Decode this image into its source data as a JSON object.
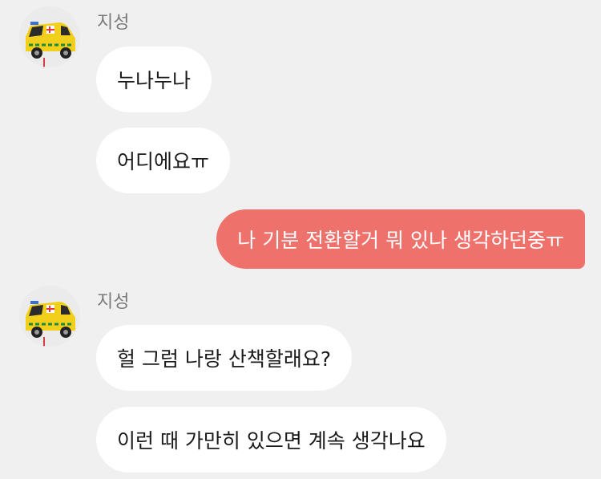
{
  "colors": {
    "background": "#f0f0f0",
    "incoming_bubble": "#ffffff",
    "outgoing_bubble": "#ee716c",
    "sender_name": "#7a7a7a"
  },
  "groups": [
    {
      "sender": "지성",
      "avatar_icon": "yellow-ambulance-toy",
      "messages": [
        "누나누나",
        "어디에요ㅠ"
      ]
    },
    {
      "sender": "me",
      "messages": [
        "나 기분 전환할거 뭐 있나 생각하던중ㅠ"
      ]
    },
    {
      "sender": "지성",
      "avatar_icon": "yellow-ambulance-toy",
      "messages": [
        "헐 그럼 나랑 산책할래요?",
        "이런 때 가만히 있으면 계속 생각나요"
      ]
    }
  ]
}
